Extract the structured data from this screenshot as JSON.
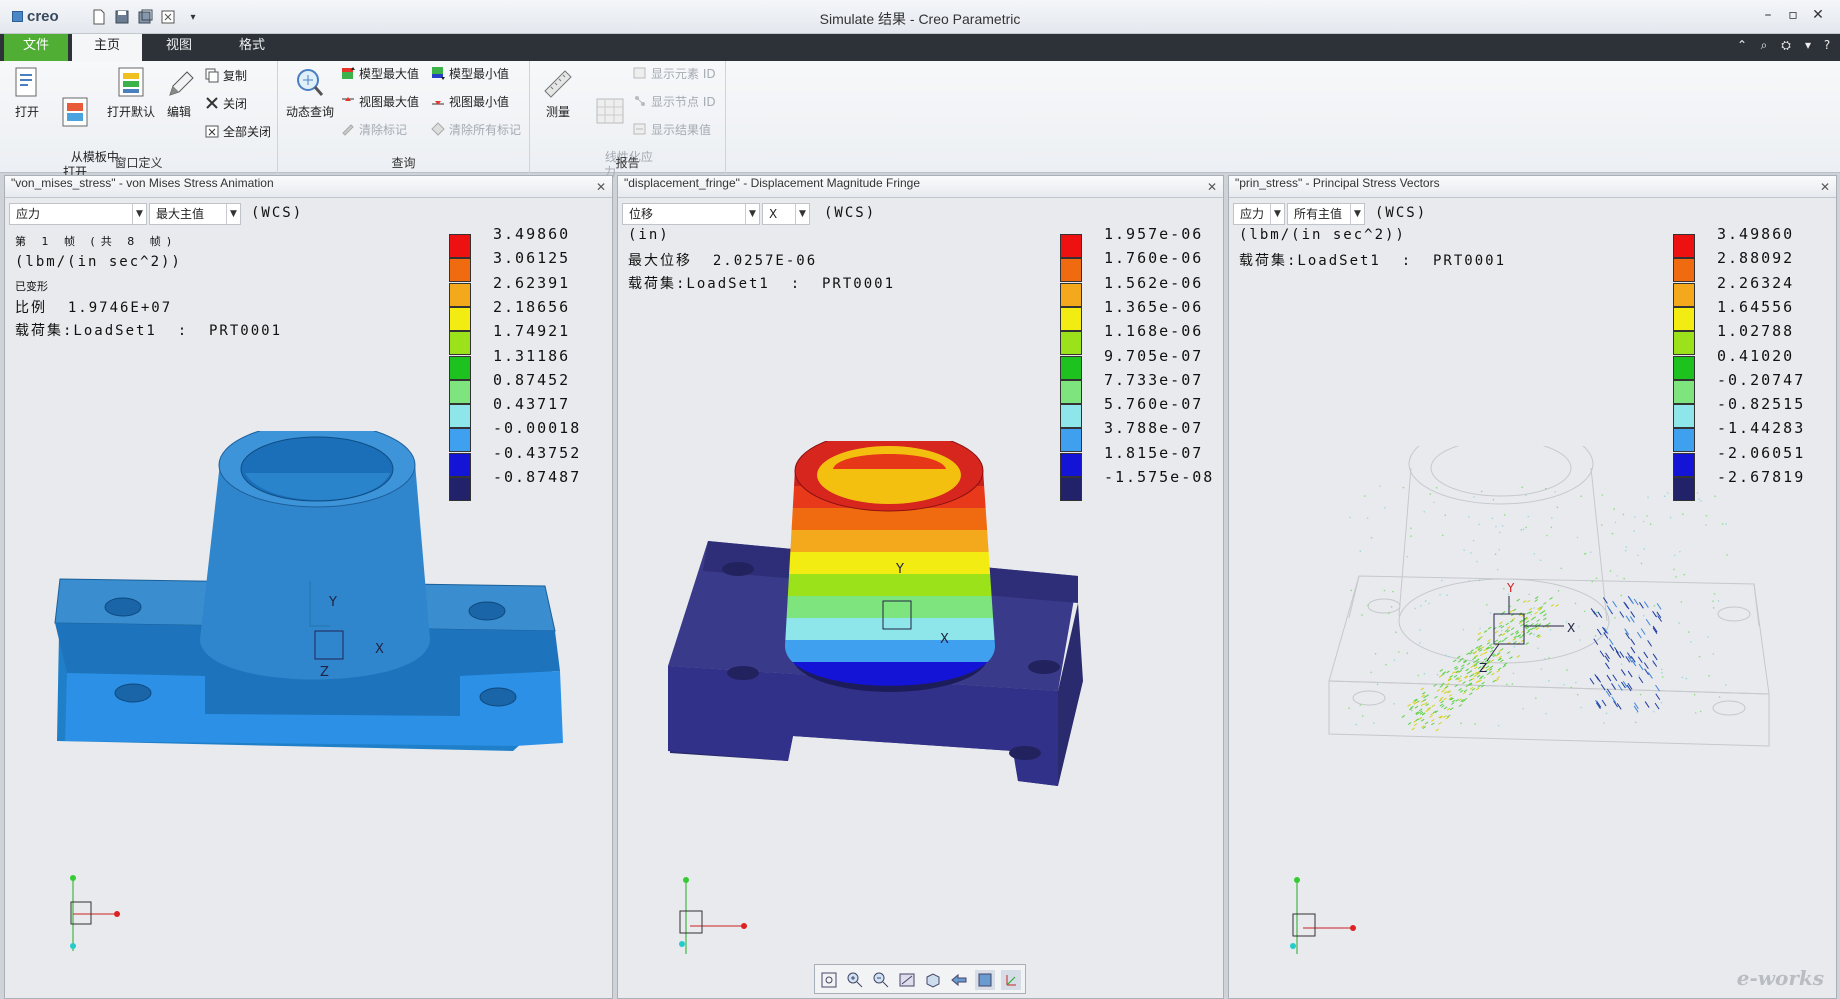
{
  "app": {
    "logo": "creo",
    "window_title": "Simulate 结果 - Creo Parametric"
  },
  "tabs": [
    {
      "label": "文件"
    },
    {
      "label": "主页"
    },
    {
      "label": "视图"
    },
    {
      "label": "格式"
    }
  ],
  "ribbon": {
    "window_def": {
      "group_label": "窗口定义",
      "open": "打开",
      "open_from_template": "从模板中\n打开",
      "open_default": "打开默认",
      "edit": "编辑",
      "copy": "复制",
      "close": "关闭",
      "close_all": "全部关闭"
    },
    "query": {
      "group_label": "查询",
      "dynamic_query": "动态查询",
      "model_max": "模型最大值",
      "model_min": "模型最小值",
      "view_max": "视图最大值",
      "view_min": "视图最小值",
      "clear_tags": "清除标记",
      "clear_all_tags": "清除所有标记"
    },
    "report": {
      "group_label": "报告",
      "measure": "测量",
      "linearize": "线性化应\n力",
      "show_element_id": "显示元素 ID",
      "show_node_id": "显示节点 ID",
      "show_result_values": "显示结果值"
    }
  },
  "panes": [
    {
      "title": "\"von_mises_stress\" - von Mises Stress Animation",
      "dropdown1": "应力",
      "dropdown2": "最大主值",
      "wcs": "(WCS)",
      "lines": [
        "第 1 帧 (共 8 帧)",
        "(lbm/(in sec^2))",
        "已变形",
        "比例  1.9746E+07",
        "载荷集:LoadSet1  :  PRT0001"
      ],
      "legend": [
        "3.49860",
        "3.06125",
        "2.62391",
        "2.18656",
        "1.74921",
        "1.31186",
        "0.87452",
        "0.43717",
        "-0.00018",
        "-0.43752",
        "-0.87487"
      ]
    },
    {
      "title": "\"displacement_fringe\" - Displacement Magnitude Fringe",
      "dropdown1": "位移",
      "dropdown2": "X",
      "wcs": "(WCS)",
      "lines": [
        "(in)",
        "最大位移  2.0257E-06",
        "载荷集:LoadSet1  :  PRT0001"
      ],
      "legend": [
        "1.957e-06",
        "1.760e-06",
        "1.562e-06",
        "1.365e-06",
        "1.168e-06",
        "9.705e-07",
        "7.733e-07",
        "5.760e-07",
        "3.788e-07",
        "1.815e-07",
        "-1.575e-08"
      ]
    },
    {
      "title": "\"prin_stress\" - Principal Stress Vectors",
      "dropdown1": "应力",
      "dropdown2": "所有主值",
      "wcs": "(WCS)",
      "lines": [
        "(lbm/(in sec^2))",
        "载荷集:LoadSet1  :  PRT0001"
      ],
      "legend": [
        "3.49860",
        "2.88092",
        "2.26324",
        "1.64556",
        "1.02788",
        "0.41020",
        "-0.20747",
        "-0.82515",
        "-1.44283",
        "-2.06051",
        "-2.67819"
      ]
    }
  ],
  "legend_colors": [
    "#ee1111",
    "#f06a10",
    "#f4a81c",
    "#f2ec12",
    "#9be21a",
    "#1ec21e",
    "#7ee47e",
    "#8ee6ea",
    "#3fa0ef",
    "#1414d6",
    "#22226a"
  ],
  "model_color": "#3a8ed0",
  "watermark": "e-works"
}
